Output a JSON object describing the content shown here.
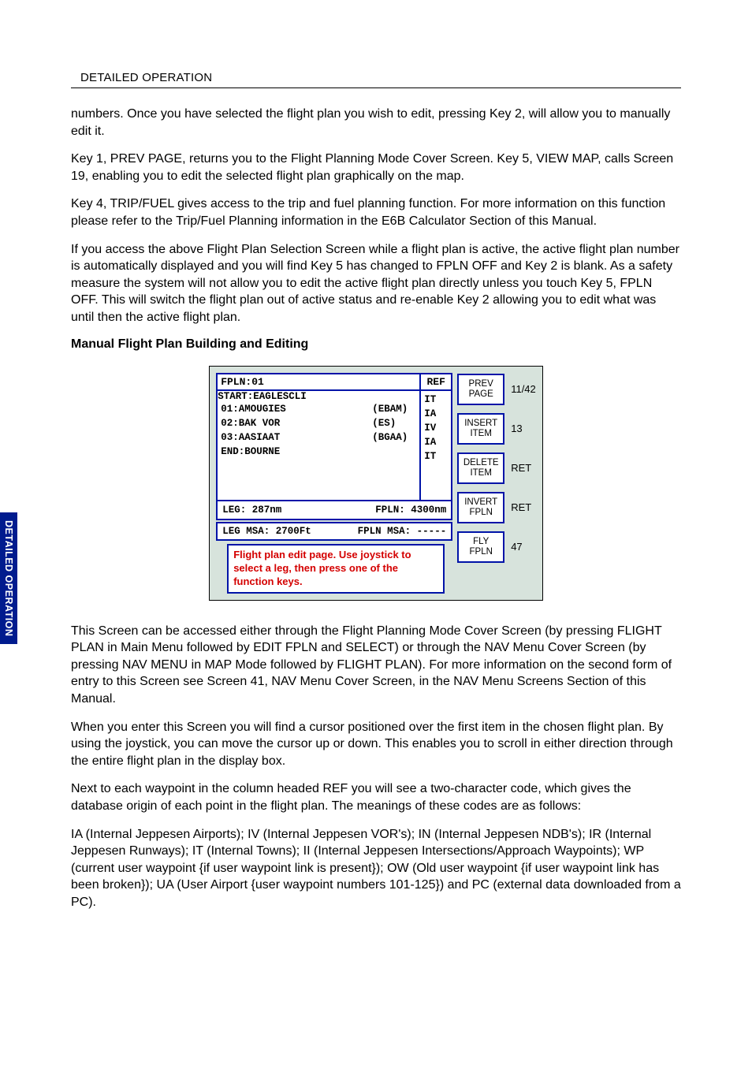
{
  "header": "DETAILED OPERATION",
  "side_tab": "DETAILED OPERATION",
  "paragraphs": {
    "p1": "numbers.  Once you have selected the flight plan you wish to edit, pressing Key 2, will allow you to manually edit it.",
    "p2": "Key 1, PREV PAGE, returns you to the Flight Planning Mode Cover Screen.  Key 5, VIEW MAP, calls Screen 19, enabling you to edit the selected flight plan graphically on the map.",
    "p3": "Key 4, TRIP/FUEL gives access to the trip and fuel planning function.  For more information on this function please refer to the Trip/Fuel Planning information in the E6B Calculator Section of this Manual.",
    "p4": "If you access the above Flight Plan Selection Screen while a flight plan is active, the active flight plan number is automatically displayed and you will find Key 5 has changed to FPLN OFF and Key 2 is blank.  As a safety measure the system will not allow you to edit the active flight plan directly unless you touch Key 5, FPLN OFF.  This will switch the flight plan out of active status and re-enable Key 2 allowing you to edit what was until then the active flight plan.",
    "subheading": "Manual Flight Plan Building and Editing",
    "p5": "This Screen can be accessed either through the Flight Planning Mode Cover Screen (by pressing FLIGHT PLAN in Main Menu followed by EDIT FPLN and SELECT) or through the NAV Menu Cover Screen (by pressing NAV MENU in MAP Mode followed by FLIGHT PLAN).  For more information on the second form of entry to this Screen see Screen 41, NAV Menu Cover Screen, in the NAV Menu Screens Section of this Manual.",
    "p6": "When you enter this Screen you will find a cursor positioned over the first item in the chosen flight plan.  By using the joystick, you can move the cursor up or down.  This enables you to scroll in either direction through the entire flight plan in the display box.",
    "p7": "Next to each waypoint in the column headed REF you will see a two-character code, which gives the database origin of each point in the flight plan.  The meanings of these codes are as follows:",
    "p8": "IA (Internal Jeppesen Airports); IV (Internal Jeppesen VOR's); IN (Internal Jeppesen NDB's); IR (Internal Jeppesen Runways); IT (Internal Towns); II (Internal Jeppesen Intersections/Approach Waypoints); WP (current user waypoint {if user waypoint link is present}); OW (Old user waypoint {if user waypoint link has been broken}); UA (User Airport {user waypoint numbers 101-125}) and PC (external data downloaded from a PC)."
  },
  "screen": {
    "fpln_label": "FPLN:01",
    "ref_header": "REF",
    "start_label": "START:EAGLESCLI",
    "rows": [
      {
        "text": "01:AMOUGIES",
        "code": "(EBAM)",
        "ref": "IA"
      },
      {
        "text": "02:BAK VOR",
        "code": "(ES)",
        "ref": "IV"
      },
      {
        "text": "03:AASIAAT",
        "code": "(BGAA)",
        "ref": "IA"
      }
    ],
    "start_ref": "IT",
    "end_label": "END:BOURNE",
    "end_ref": "IT",
    "leg_label": "LEG: 287nm",
    "fpln_dist": "FPLN: 4300nm",
    "leg_msa": "LEG  MSA: 2700Ft",
    "fpln_msa": "FPLN  MSA: -----",
    "hint": "Flight plan edit page. Use joystick to select a leg, then press one of the function keys.",
    "buttons": [
      {
        "label": "PREV\nPAGE",
        "side": "11/42"
      },
      {
        "label": "INSERT\nITEM",
        "side": "13"
      },
      {
        "label": "DELETE\nITEM",
        "side": "RET"
      },
      {
        "label": "INVERT\nFPLN",
        "side": "RET"
      },
      {
        "label": "FLY\nFPLN",
        "side": "47"
      }
    ]
  }
}
